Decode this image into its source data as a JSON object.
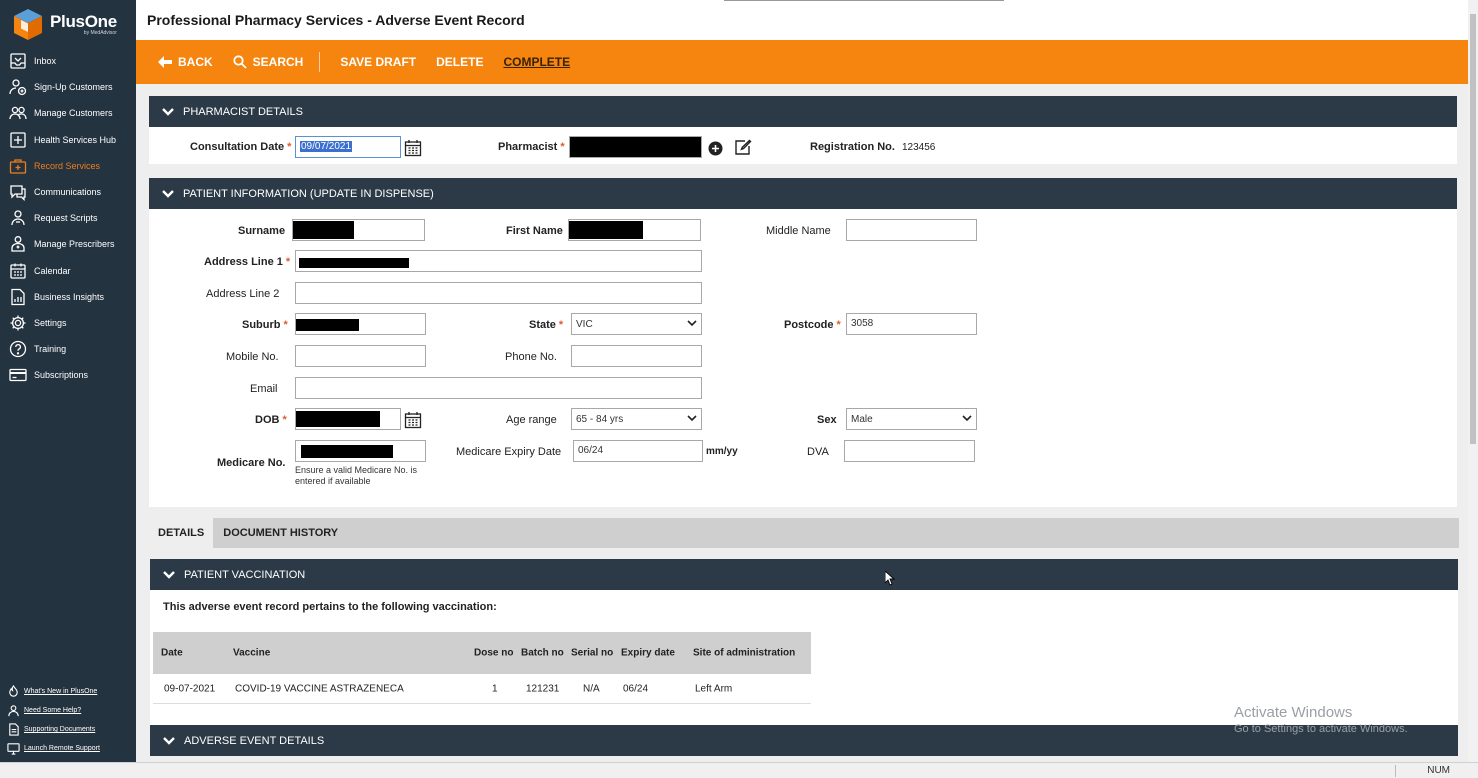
{
  "app": {
    "logo_name": "PlusOne",
    "logo_sub": "by MedAdvisor",
    "page_title": "Professional Pharmacy Services - Adverse Event Record",
    "accent_color": "#f5850f",
    "sidebar_color": "#243340"
  },
  "sidebar": {
    "items": [
      {
        "label": "Inbox",
        "icon": "inbox-icon"
      },
      {
        "label": "Sign-Up Customers",
        "icon": "signup-icon"
      },
      {
        "label": "Manage Customers",
        "icon": "customers-icon"
      },
      {
        "label": "Health Services Hub",
        "icon": "health-hub-icon"
      },
      {
        "label": "Record Services",
        "icon": "record-icon",
        "active": true
      },
      {
        "label": "Communications",
        "icon": "chat-icon"
      },
      {
        "label": "Request Scripts",
        "icon": "script-icon"
      },
      {
        "label": "Manage Prescribers",
        "icon": "prescriber-icon"
      },
      {
        "label": "Calendar",
        "icon": "calendar-icon"
      },
      {
        "label": "Business Insights",
        "icon": "insights-icon"
      },
      {
        "label": "Settings",
        "icon": "gear-icon"
      },
      {
        "label": "Training",
        "icon": "help-icon"
      },
      {
        "label": "Subscriptions",
        "icon": "card-icon"
      }
    ],
    "footer": [
      {
        "label": "What's New in PlusOne"
      },
      {
        "label": "Need Some Help?"
      },
      {
        "label": "Supporting Documents"
      },
      {
        "label": "Launch Remote Support"
      }
    ]
  },
  "toolbar": {
    "back": "BACK",
    "search": "SEARCH",
    "save_draft": "SAVE DRAFT",
    "delete": "DELETE",
    "complete": "COMPLETE"
  },
  "pharmacist": {
    "section_title": "PHARMACIST DETAILS",
    "consultation_date_label": "Consultation Date",
    "consultation_date_value": "09/07/2021",
    "pharmacist_label": "Pharmacist",
    "registration_label": "Registration No.",
    "registration_value": "123456"
  },
  "patient": {
    "section_title": "PATIENT INFORMATION (UPDATE IN DISPENSE)",
    "surname_label": "Surname",
    "first_name_label": "First Name",
    "middle_name_label": "Middle Name",
    "address1_label": "Address Line 1",
    "address2_label": "Address Line 2",
    "suburb_label": "Suburb",
    "state_label": "State",
    "state_value": "VIC",
    "postcode_label": "Postcode",
    "postcode_value": "3058",
    "mobile_label": "Mobile No.",
    "phone_label": "Phone No.",
    "email_label": "Email",
    "dob_label": "DOB",
    "age_range_label": "Age range",
    "age_range_value": "65 - 84 yrs",
    "sex_label": "Sex",
    "sex_value": "Male",
    "medicare_label": "Medicare No.",
    "medicare_hint": "Ensure a valid Medicare No. is entered if available",
    "medicare_expiry_label": "Medicare Expiry Date",
    "medicare_expiry_value": "06/24",
    "medicare_expiry_unit": "mm/yy",
    "dva_label": "DVA"
  },
  "tabs": [
    "DETAILS",
    "DOCUMENT HISTORY"
  ],
  "vaccination": {
    "section_title": "PATIENT VACCINATION",
    "intro": "This adverse event record pertains to the following vaccination:",
    "columns": [
      "Date",
      "Vaccine",
      "Dose no",
      "Batch no",
      "Serial no",
      "Expiry date",
      "Site of administration"
    ],
    "rows": [
      [
        "09-07-2021",
        "COVID-19 VACCINE ASTRAZENECA",
        "1",
        "121231",
        "N/A",
        "06/24",
        "Left Arm"
      ]
    ]
  },
  "adverse": {
    "section_title": "ADVERSE EVENT DETAILS"
  },
  "watermark": {
    "line1": "Activate Windows",
    "line2": "Go to Settings to activate Windows."
  },
  "statusbar": {
    "num": "NUM"
  }
}
